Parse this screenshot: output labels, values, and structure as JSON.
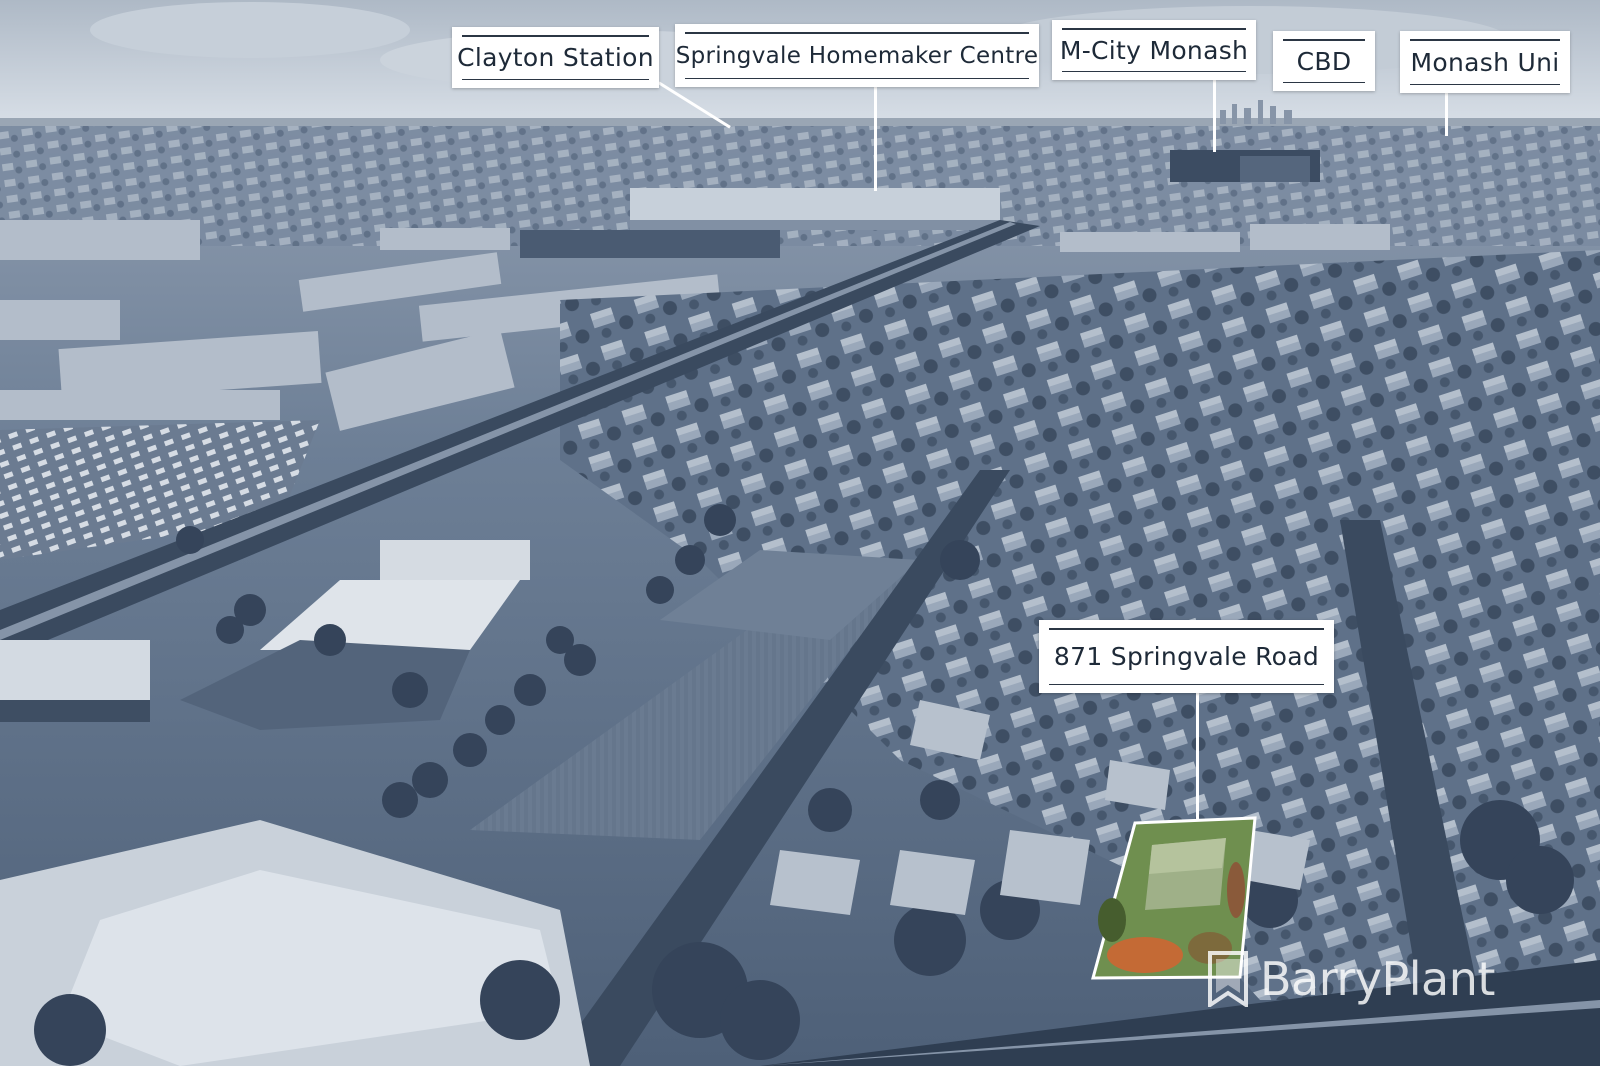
{
  "labels": {
    "clayton": "Clayton Station",
    "homemaker": "Springvale Homemaker Centre",
    "mcity": "M-City Monash",
    "cbd": "CBD",
    "monash": "Monash Uni",
    "property": "871 Springvale Road"
  },
  "brand": {
    "name": "BarryPlant",
    "logo_icon": "barry-plant-flag-icon"
  },
  "colors": {
    "tint": "#5d6f86",
    "sky": "#bfc9d4",
    "label_bg": "#ffffff",
    "property_green": "#6f8f4f",
    "property_autumn": "#c46a35"
  }
}
